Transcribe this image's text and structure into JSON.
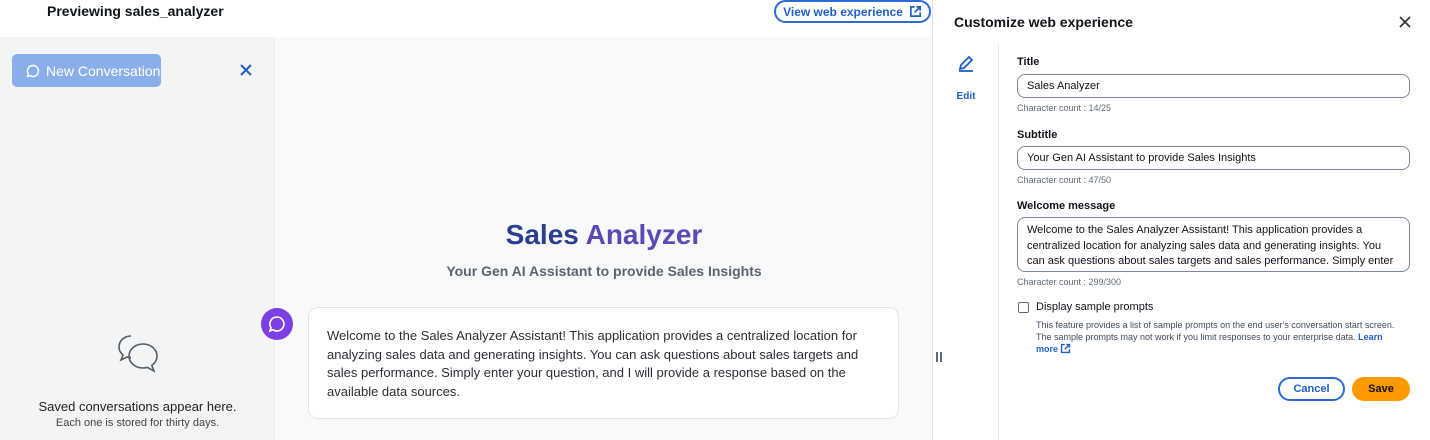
{
  "topbar": {
    "preview_title": "Previewing sales_analyzer",
    "view_button_label": "View web experience"
  },
  "sidebar": {
    "new_conversation_label": "New Conversation",
    "saved_text": "Saved conversations appear here.",
    "saved_subtext": "Each one is stored for thirty days."
  },
  "main": {
    "title_word1": "Sales",
    "title_word2": "Analyzer",
    "subtitle": "Your Gen AI Assistant to provide Sales Insights",
    "welcome_message": "Welcome to the Sales Analyzer Assistant! This application provides a centralized location for analyzing sales data and generating insights. You can ask questions about sales targets and sales performance. Simply enter your question, and I will provide a response based on the available data sources."
  },
  "panel": {
    "header_title": "Customize web experience",
    "rail_edit_label": "Edit",
    "title_label": "Title",
    "title_value": "Sales Analyzer",
    "title_count": "Character count : 14/25",
    "subtitle_label": "Subtitle",
    "subtitle_value": "Your Gen AI Assistant to provide Sales Insights",
    "subtitle_count": "Character count : 47/50",
    "welcome_label": "Welcome message",
    "welcome_value": "Welcome to the Sales Analyzer Assistant! This application provides a centralized location for analyzing sales data and generating insights. You can ask questions about sales targets and sales performance. Simply enter",
    "welcome_count": "Character count : 299/300",
    "sample_prompts_label": "Display sample prompts",
    "sample_prompts_checked": false,
    "sample_prompts_desc": "This feature provides a list of sample prompts on the end user's conversation start screen. The sample prompts may not work if you limit responses to your enterprise data.",
    "learn_more_label": "Learn more",
    "cancel_label": "Cancel",
    "save_label": "Save"
  },
  "colors": {
    "accent_blue": "#1f5fc7",
    "save_orange": "#ff9900",
    "avatar_purple": "#7b3fe4",
    "title_blue": "#2a3f8f",
    "title_purple": "#5b4ab5"
  },
  "icons": [
    "external-link-icon",
    "chat-bubble-icon",
    "close-icon",
    "saved-conversations-icon",
    "bot-avatar-icon",
    "pencil-icon",
    "drag-handle-icon"
  ]
}
